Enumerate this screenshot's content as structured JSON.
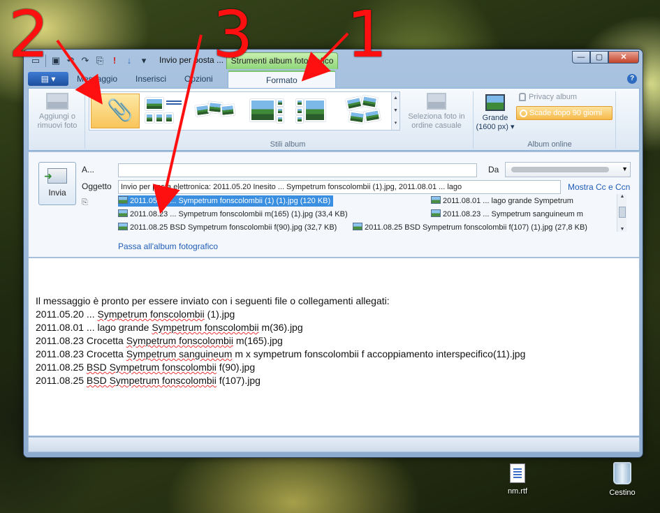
{
  "window": {
    "title": "Invio per posta ...",
    "context_tab": "Strumenti album fotografico",
    "controls": {
      "minimize": "—",
      "maximize": "▢",
      "close": "✕"
    }
  },
  "quick_access": {
    "icons": [
      "new-message-icon",
      "save-icon",
      "undo-icon",
      "redo-icon",
      "attach-icon",
      "priority-icon",
      "low-priority-icon",
      "customize-icon"
    ]
  },
  "ribbon_tabs": {
    "app_button": "▤ ▾",
    "tabs": [
      "Messaggio",
      "Inserisci",
      "Opzioni",
      "Formato"
    ],
    "active": "Formato"
  },
  "ribbon": {
    "add_remove": "Aggiungi o rimuovi foto",
    "shuffle": "Seleziona foto in ordine casuale",
    "album_styles_label": "Stili album",
    "size_label": "Grande",
    "size_value": "(1600 px)",
    "privacy": "Privacy album",
    "expire": "Scade dopo 90 giorni",
    "online_album_label": "Album online"
  },
  "header": {
    "send": "Invia",
    "to_label": "A...",
    "to_value": "",
    "from_label": "Da",
    "from_value": "",
    "subject_label": "Oggetto",
    "subject_value": "Invio per posta elettronica: 2011.05.20 Inesito ... Sympetrum fonscolombii (1).jpg, 2011.08.01 ... lago",
    "show_cc": "Mostra Cc e Ccn",
    "attachments": [
      {
        "text": "2011.05.20 ... Sympetrum fonscolombii (1) (1).jpg (120 KB)",
        "selected": true
      },
      {
        "text": "2011.08.01 ... lago grande Sympetrum",
        "selected": false
      },
      {
        "text": "2011.08.23 ... Sympetrum fonscolombii m(165) (1).jpg (33,4 KB)",
        "selected": false
      },
      {
        "text": "2011.08.23 ... Sympetrum sanguineum m",
        "selected": false
      },
      {
        "text": "2011.08.25 BSD Sympetrum fonscolombii f(90).jpg (32,7 KB)",
        "selected": false
      },
      {
        "text": "2011.08.25 BSD Sympetrum fonscolombii f(107) (1).jpg (27,8 KB)",
        "selected": false
      }
    ],
    "switch_album": "Passa all'album fotografico"
  },
  "body": {
    "intro": "Il messaggio è pronto per essere inviato con i seguenti file o collegamenti allegati:",
    "lines": [
      {
        "pre": "2011.05.20 ... ",
        "sp": "Sympetrum fonscolombii",
        "post": " (1).jpg"
      },
      {
        "pre": "2011.08.01 ... lago grande ",
        "sp": "Sympetrum fonscolombii",
        "post": " m(36).jpg"
      },
      {
        "pre": "2011.08.23 Crocetta ",
        "sp": "Sympetrum fonscolombii",
        "post": " m(165).jpg"
      },
      {
        "pre": "2011.08.23 Crocetta ",
        "sp": "Sympetrum sanguineum",
        "post": " m x sympetrum fonscolombii f accoppiamento interspecifico(11).jpg"
      },
      {
        "pre": "2011.08.25 ",
        "sp": "BSD Sympetrum fonscolombii",
        "post": " f(90).jpg"
      },
      {
        "pre": "2011.08.25 ",
        "sp": "BSD Sympetrum fonscolombii",
        "post": " f(107).jpg"
      }
    ]
  },
  "annotations": [
    "2",
    "3",
    "1"
  ],
  "desktop": {
    "icons": [
      {
        "label": "nm.rtf",
        "icon": "rtf-file-icon"
      },
      {
        "label": "Cestino",
        "icon": "recycle-bin-icon"
      }
    ]
  },
  "colors": {
    "accent": "#3b8fe0",
    "context_tab": "#8fd67a",
    "selected_style": "#f9c45a",
    "annotation": "#ff1010"
  }
}
